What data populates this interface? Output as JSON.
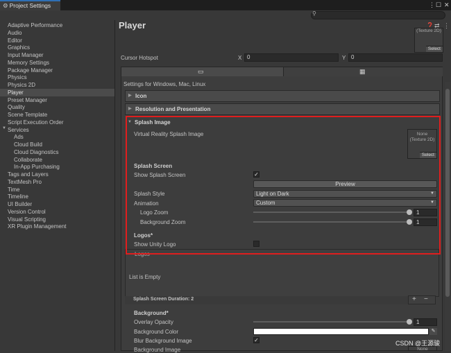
{
  "window": {
    "tab_title": "Project Settings",
    "search_placeholder": ""
  },
  "sidebar": {
    "items": [
      {
        "label": "Adaptive Performance"
      },
      {
        "label": "Audio"
      },
      {
        "label": "Editor"
      },
      {
        "label": "Graphics"
      },
      {
        "label": "Input Manager"
      },
      {
        "label": "Memory Settings"
      },
      {
        "label": "Package Manager"
      },
      {
        "label": "Physics"
      },
      {
        "label": "Physics 2D"
      },
      {
        "label": "Player",
        "selected": true
      },
      {
        "label": "Preset Manager"
      },
      {
        "label": "Quality"
      },
      {
        "label": "Scene Template"
      },
      {
        "label": "Script Execution Order"
      },
      {
        "label": "Services",
        "expanded": true
      },
      {
        "label": "Ads",
        "sub": true
      },
      {
        "label": "Cloud Build",
        "sub": true
      },
      {
        "label": "Cloud Diagnostics",
        "sub": true
      },
      {
        "label": "Collaborate",
        "sub": true
      },
      {
        "label": "In-App Purchasing",
        "sub": true
      },
      {
        "label": "Tags and Layers"
      },
      {
        "label": "TextMesh Pro"
      },
      {
        "label": "Time"
      },
      {
        "label": "Timeline"
      },
      {
        "label": "UI Builder"
      },
      {
        "label": "Version Control"
      },
      {
        "label": "Visual Scripting"
      },
      {
        "label": "XR Plugin Management"
      }
    ]
  },
  "main": {
    "title": "Player",
    "top_thumb": {
      "text": "(Texture 2D)",
      "select": "Select"
    },
    "cursor_hotspot": {
      "label": "Cursor Hotspot",
      "x_label": "X",
      "x_value": "0",
      "y_label": "Y",
      "y_value": "0"
    },
    "platform_caption": "Settings for Windows, Mac, Linux",
    "sections": {
      "icon": "Icon",
      "resolution": "Resolution and Presentation",
      "splash": "Splash Image"
    },
    "splash": {
      "vr_label": "Virtual Reality Splash Image",
      "vr_thumb": {
        "line1": "None",
        "line2": "(Texture 2D)",
        "select": "Select"
      },
      "splash_screen_header": "Splash Screen",
      "show_splash_label": "Show Splash Screen",
      "show_splash_checked": "✓",
      "preview_button": "Preview",
      "splash_style_label": "Splash Style",
      "splash_style_value": "Light on Dark",
      "animation_label": "Animation",
      "animation_value": "Custom",
      "logo_zoom_label": "Logo Zoom",
      "logo_zoom_value": "1",
      "background_zoom_label": "Background Zoom",
      "background_zoom_value": "1",
      "logos_header": "Logos*",
      "show_unity_logo_label": "Show Unity Logo",
      "logos_list_header": "Logos",
      "list_empty": "List is Empty",
      "duration": "Splash Screen Duration: 2",
      "add_btn": "+",
      "remove_btn": "−",
      "background_header": "Background*",
      "overlay_opacity_label": "Overlay Opacity",
      "overlay_opacity_value": "1",
      "background_color_label": "Background Color",
      "blur_label": "Blur Background Image",
      "blur_checked": "✓",
      "background_image_label": "Background Image",
      "background_image_thumb": "None"
    }
  },
  "watermark": "CSDN @王源骏",
  "colors": {
    "highlight": "#e01e1e",
    "selection": "#4b4b4b",
    "tab_accent": "#2f6fb5"
  }
}
